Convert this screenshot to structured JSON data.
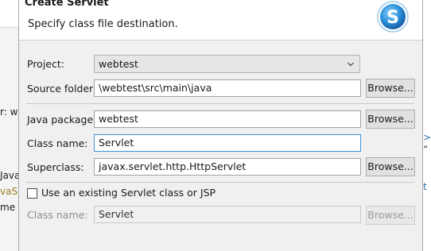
{
  "background": {
    "left_fragments": [
      "r: we",
      "Java",
      "vaSE",
      "me To"
    ],
    "right_fragments": [
      ">",
      "„",
      "t"
    ]
  },
  "dialog": {
    "title": "Create Servlet",
    "subtitle": "Specify class file destination.",
    "icon": "servlet-wizard-icon"
  },
  "form": {
    "project_label": "Project:",
    "project_value": "webtest",
    "source_folder_label": "Source folder:",
    "source_folder_value": "\\webtest\\src\\main\\java",
    "java_package_label": "Java package:",
    "java_package_value": "webtest",
    "class_name_label": "Class name:",
    "class_name_value": "Servlet",
    "superclass_label": "Superclass:",
    "superclass_value": "javax.servlet.http.HttpServlet",
    "existing_checkbox_label": "Use an existing Servlet class or JSP",
    "existing_checkbox_checked": false,
    "existing_class_label": "Class name:",
    "existing_class_value": "Servlet"
  },
  "buttons": {
    "browse_source": "Browse...",
    "browse_package": "Browse...",
    "browse_superclass": "Browse...",
    "browse_existing": "Browse..."
  },
  "colors": {
    "focus_border": "#3d8fd6",
    "icon_blue": "#2a8fd8"
  }
}
